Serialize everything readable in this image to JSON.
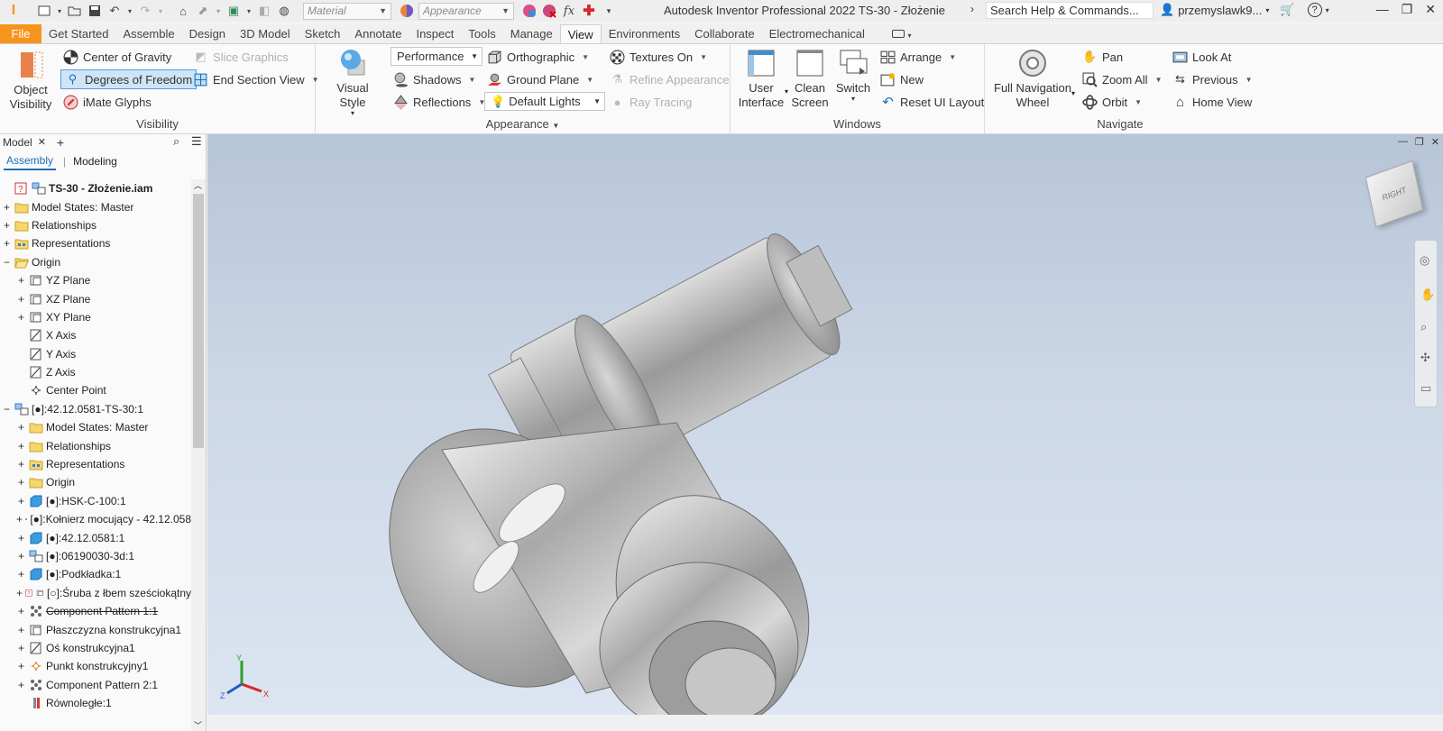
{
  "titlebar": {
    "material_placeholder": "Material",
    "appearance_placeholder": "Appearance",
    "title": "Autodesk Inventor Professional 2022   TS-30 - Złożenie",
    "search_placeholder": "Search Help & Commands...",
    "user": "przemyslawk9..."
  },
  "tabs": [
    "File",
    "Get Started",
    "Assemble",
    "Design",
    "3D Model",
    "Sketch",
    "Annotate",
    "Inspect",
    "Tools",
    "Manage",
    "View",
    "Environments",
    "Collaborate",
    "Electromechanical"
  ],
  "active_tab": "View",
  "ribbon": {
    "visibility": {
      "title": "Visibility",
      "object_visibility": "Object\nVisibility",
      "center_of_gravity": "Center of Gravity",
      "degrees_of_freedom": "Degrees of Freedom",
      "imate_glyphs": "iMate Glyphs",
      "slice_graphics": "Slice Graphics",
      "end_section_view": "End Section View"
    },
    "appearance": {
      "title": "Appearance",
      "visual_style": "Visual Style",
      "performance": "Performance",
      "shadows": "Shadows",
      "reflections": "Reflections",
      "orthographic": "Orthographic",
      "ground_plane": "Ground Plane",
      "default_lights": "Default Lights",
      "textures_on": "Textures On",
      "refine_appearance": "Refine Appearance",
      "ray_tracing": "Ray Tracing"
    },
    "windows": {
      "title": "Windows",
      "user_interface": "User\nInterface",
      "clean_screen": "Clean\nScreen",
      "switch": "Switch",
      "arrange": "Arrange",
      "new": "New",
      "reset_ui_layout": "Reset UI Layout"
    },
    "navigate": {
      "title": "Navigate",
      "full_navigation_wheel": "Full Navigation\nWheel",
      "pan": "Pan",
      "zoom_all": "Zoom All",
      "orbit": "Orbit",
      "look_at": "Look At",
      "previous": "Previous",
      "home_view": "Home View"
    }
  },
  "browser": {
    "tab_label": "Model",
    "sub_tabs": [
      "Assembly",
      "Modeling"
    ],
    "tree": [
      {
        "label": "TS-30 - Złożenie.iam",
        "indent": 0,
        "exp": "",
        "icon": "assembly-root",
        "bold": true
      },
      {
        "label": "Model States: Master",
        "indent": 0,
        "exp": "+",
        "icon": "folder"
      },
      {
        "label": "Relationships",
        "indent": 0,
        "exp": "+",
        "icon": "folder"
      },
      {
        "label": "Representations",
        "indent": 0,
        "exp": "+",
        "icon": "folder-rep"
      },
      {
        "label": "Origin",
        "indent": 0,
        "exp": "−",
        "icon": "folder-open"
      },
      {
        "label": "YZ Plane",
        "indent": 1,
        "exp": "+",
        "icon": "plane"
      },
      {
        "label": "XZ Plane",
        "indent": 1,
        "exp": "+",
        "icon": "plane"
      },
      {
        "label": "XY Plane",
        "indent": 1,
        "exp": "+",
        "icon": "plane"
      },
      {
        "label": "X Axis",
        "indent": 1,
        "exp": "",
        "icon": "axis"
      },
      {
        "label": "Y Axis",
        "indent": 1,
        "exp": "",
        "icon": "axis"
      },
      {
        "label": "Z Axis",
        "indent": 1,
        "exp": "",
        "icon": "axis"
      },
      {
        "label": "Center Point",
        "indent": 1,
        "exp": "",
        "icon": "point"
      },
      {
        "label": "[●]:42.12.0581-TS-30:1",
        "indent": 0,
        "exp": "−",
        "icon": "subassembly"
      },
      {
        "label": "Model States: Master",
        "indent": 1,
        "exp": "+",
        "icon": "folder"
      },
      {
        "label": "Relationships",
        "indent": 1,
        "exp": "+",
        "icon": "folder"
      },
      {
        "label": "Representations",
        "indent": 1,
        "exp": "+",
        "icon": "folder-rep"
      },
      {
        "label": "Origin",
        "indent": 1,
        "exp": "+",
        "icon": "folder"
      },
      {
        "label": "[●]:HSK-C-100:1",
        "indent": 1,
        "exp": "+",
        "icon": "part"
      },
      {
        "label": "[●]:Kołnierz mocujący - 42.12.058",
        "indent": 1,
        "exp": "+",
        "icon": "part"
      },
      {
        "label": "[●]:42.12.0581:1",
        "indent": 1,
        "exp": "+",
        "icon": "part"
      },
      {
        "label": "[●]:06190030-3d:1",
        "indent": 1,
        "exp": "+",
        "icon": "subassembly"
      },
      {
        "label": "[●]:Podkładka:1",
        "indent": 1,
        "exp": "+",
        "icon": "part"
      },
      {
        "label": "[○]:Śruba z łbem sześciokątny",
        "indent": 1,
        "exp": "+",
        "icon": "unknown"
      },
      {
        "label": "Component Pattern 1:1",
        "indent": 1,
        "exp": "+",
        "icon": "pattern",
        "strike": true
      },
      {
        "label": "Płaszczyzna konstrukcyjna1",
        "indent": 1,
        "exp": "+",
        "icon": "plane"
      },
      {
        "label": "Oś konstrukcyjna1",
        "indent": 1,
        "exp": "+",
        "icon": "axis"
      },
      {
        "label": "Punkt konstrukcyjny1",
        "indent": 1,
        "exp": "+",
        "icon": "point-orange"
      },
      {
        "label": "Component Pattern 2:1",
        "indent": 1,
        "exp": "+",
        "icon": "pattern"
      },
      {
        "label": "Równoległe:1",
        "indent": 1,
        "exp": "",
        "icon": "constraint"
      }
    ]
  },
  "viewcube": {
    "face_label": "RIGHT"
  },
  "triad": {
    "x": "X",
    "y": "Y",
    "z": "Z"
  },
  "colors": {
    "file_tab": "#f7941d",
    "highlight": "#cfe4f7",
    "accent": "#1a6fb8"
  }
}
